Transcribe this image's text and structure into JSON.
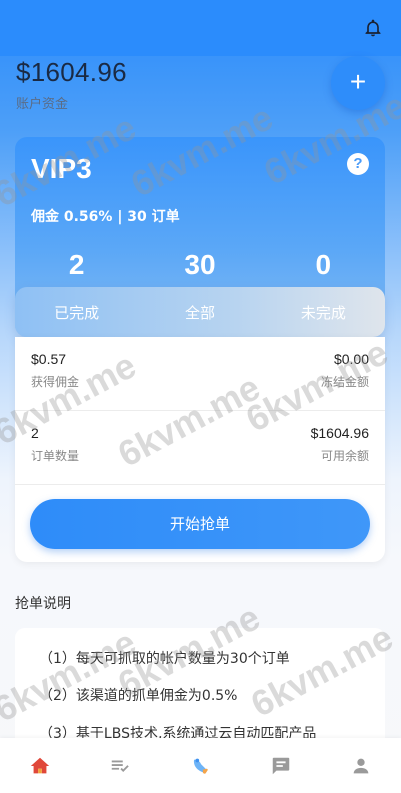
{
  "balance": {
    "amount": "$1604.96",
    "label": "账户资金"
  },
  "fab": {
    "label": "+"
  },
  "vip": {
    "title": "VIP3",
    "help": "?",
    "subtitle": "佣金 0.56% | 30 订单",
    "stats": [
      {
        "value": "2",
        "label": "已完成"
      },
      {
        "value": "30",
        "label": "全部"
      },
      {
        "value": "0",
        "label": "未完成"
      }
    ]
  },
  "info": {
    "commission": {
      "value": "$0.57",
      "label": "获得佣金"
    },
    "frozen": {
      "value": "$0.00",
      "label": "冻结金额"
    },
    "order_count": {
      "value": "2",
      "label": "订单数量"
    },
    "available": {
      "value": "$1604.96",
      "label": "可用余额"
    },
    "start_button": "开始抢单"
  },
  "notes": {
    "title": "抢单说明",
    "items": [
      "（1）每天可抓取的帐户数量为30个订单",
      "（2）该渠道的抓单佣金为0.5%",
      "（3）基于LBS技术,系统通过云自动匹配产品"
    ]
  },
  "watermark": "6kvm.me",
  "tabs": [
    {
      "icon": "home-icon"
    },
    {
      "icon": "list-check-icon"
    },
    {
      "icon": "grab-order-icon"
    },
    {
      "icon": "chat-icon"
    },
    {
      "icon": "user-icon"
    }
  ],
  "colors": {
    "primary": "#2b8cfc",
    "active_tab": "#e0483a",
    "inactive_tab": "#9a9a9a"
  }
}
